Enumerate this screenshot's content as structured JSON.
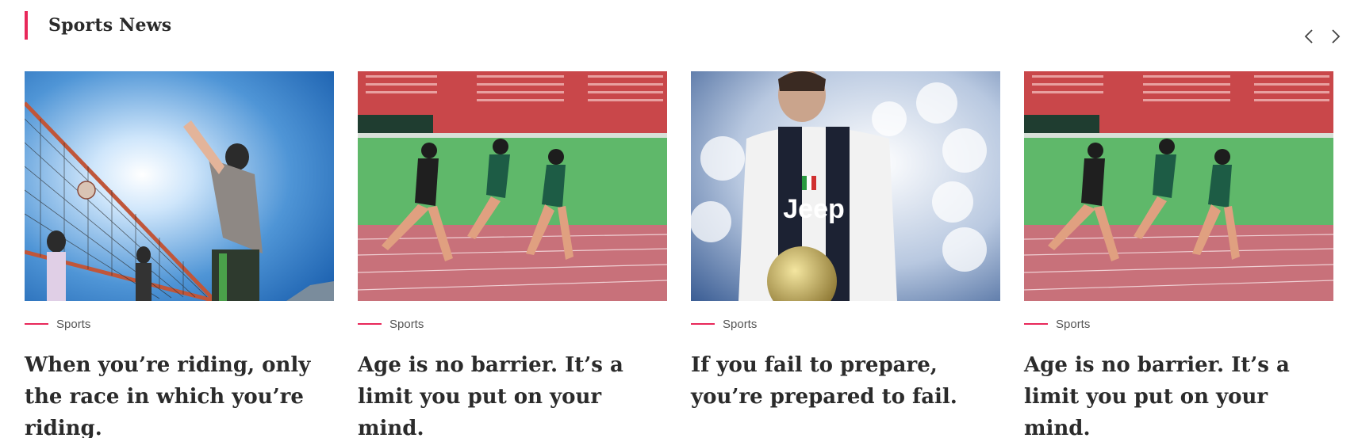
{
  "section": {
    "title": "Sports News"
  },
  "nav": {
    "prev_icon": "chevron-left-icon",
    "next_icon": "chevron-right-icon"
  },
  "accent_color": "#e8285a",
  "cards": [
    {
      "category": "Sports",
      "title": "When you’re riding, only the race in which you’re riding.",
      "image": "volleyball-players-photo"
    },
    {
      "category": "Sports",
      "title": "Age is no barrier. It’s a limit you put on your mind.",
      "image": "sprinters-on-track-photo"
    },
    {
      "category": "Sports",
      "title": "If you fail to prepare, you’re prepared to fail.",
      "image": "footballer-with-ball-photo"
    },
    {
      "category": "Sports",
      "title": "Age is no barrier. It’s a limit you put on your mind.",
      "image": "sprinters-on-track-photo"
    }
  ]
}
